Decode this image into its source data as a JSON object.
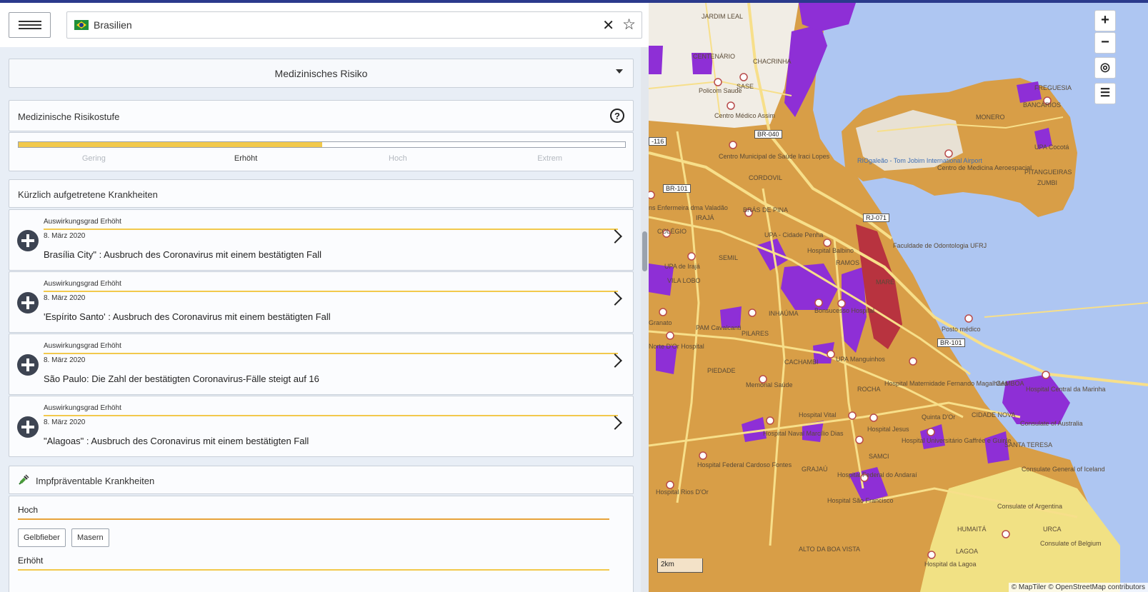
{
  "header": {
    "country": "Brasilien",
    "menu_icon": "hamburger-icon",
    "clear_icon": "close-icon",
    "favorite_icon": "star-icon"
  },
  "dropdown": {
    "label": "Medizinisches Risiko"
  },
  "risk": {
    "title": "Medizinische Risikostufe",
    "levels": [
      "Gering",
      "Erhöht",
      "Hoch",
      "Extrem"
    ],
    "active_level": "Erhöht",
    "fill_fraction": 0.5,
    "fill_color": "#f2c94c"
  },
  "recent": {
    "title": "Kürzlich aufgetretene Krankheiten",
    "items": [
      {
        "severity": "Auswirkungsgrad Erhöht",
        "date": "8. März 2020",
        "title": "Brasília City\" : Ausbruch des Coronavirus mit einem bestätigten Fall"
      },
      {
        "severity": "Auswirkungsgrad Erhöht",
        "date": "8. März 2020",
        "title": "'Espírito Santo' : Ausbruch des Coronavirus mit einem bestätigten Fall"
      },
      {
        "severity": "Auswirkungsgrad Erhöht",
        "date": "8. März 2020",
        "title": "São Paulo: Die Zahl der bestätigten Coronavirus-Fälle steigt auf 16"
      },
      {
        "severity": "Auswirkungsgrad Erhöht",
        "date": "8. März 2020",
        "title": "\"Alagoas\" : Ausbruch des Coronavirus mit einem bestätigten Fall"
      }
    ]
  },
  "vaccine": {
    "title": "Impfpräventable Krankheiten",
    "level_high": "Hoch",
    "level_high_color": "#e8a33a",
    "tags": [
      "Gelbfieber",
      "Masern"
    ],
    "level_elevated": "Erhöht",
    "level_elevated_color": "#f2c94c"
  },
  "map": {
    "zoom_in": "+",
    "zoom_out": "−",
    "scale": "2km",
    "attribution": "© MapTiler © OpenStreetMap contributors",
    "labels": {
      "jardim_leal": "JARDIM LEAL",
      "centenario": "CENTENÁRIO",
      "chacrinha": "CHACRINHA",
      "policom": "Policom Saude",
      "sase": "SASE",
      "centro_medico": "Centro Médico Assim",
      "freguesia": "FREGUESIA",
      "bancarios": "BANCÁRIOS",
      "monero": "MONERO",
      "upa_cocota": "UPA Cocotá",
      "pitangueiras": "PITANGUEIRAS",
      "zumbi": "ZUMBI",
      "rio_galeao": "RIOgaleão - Tom Jobim International Airport",
      "centro_med_aero": "Centro de Medicina Aeroespacial",
      "centro_municipal": "Centro Municipal de Saúde Iraci Lopes",
      "cordovil": "CORDOVIL",
      "bras_de_pina": "BRÁS DE PINA",
      "iraja": "IRAJÁ",
      "enfermeira": "ns Enfermeira dma Valadão",
      "colegio": "COLÉGIO",
      "upa_penha": "UPA - Cidade Penha",
      "hospital_balbino": "Hospital Balbino",
      "faculdade": "Faculdade de Odontologia UFRJ",
      "semil": "SEMIL",
      "upa_iraja": "UPA de Irajá",
      "vila_lobo": "VILA LOBO",
      "ramos": "RAMOS",
      "mare": "MARÉ",
      "bonsucesso": "Bonsucesso Hospital",
      "inhauma": "INHAÚMA",
      "pam_cavalcanti": "PAM Cavalcanti",
      "pilares": "PILARES",
      "granato": "Granato",
      "norte_dor": "Norte D'Or Hospital",
      "upa_manguinhos": "UPA Manguinhos",
      "cachambi": "CACHAMBI",
      "posto_medico": "Posto médico",
      "piedade": "PIEDADE",
      "memorial_saude": "Memorial Saúde",
      "rocha": "ROCHA",
      "hospital_maternidade": "Hospital Maternidade Fernando Magalhães",
      "gamboa": "GAMBOA",
      "hospital_marinha": "Hospital Central da Marinha",
      "hospital_vital": "Hospital Vital",
      "hospital_jesus": "Hospital Jesus",
      "quinta_dor": "Quinta D'Or",
      "cidade_nova": "CIDADE NOVA",
      "consulate_australia": "Consulate of Australia",
      "hospital_naval": "Hospital Naval Marcílio Dias",
      "hospital_universitario": "Hospital Universitário Gaffrée e Guinle",
      "samci": "SAMCI",
      "santa_teresa": "SANTA TERESA",
      "hospital_federal": "Hospital Federal Cardoso Fontes",
      "grajau": "GRAJAÚ",
      "hospital_andarai": "Hospital Federal do Andaraí",
      "consulate_iceland": "Consulate General of Iceland",
      "hospital_rios_dor": "Hospital Rios D'Or",
      "hospital_sao_francisco": "Hospital São Francisco",
      "consulate_argentina": "Consulate of Argentina",
      "alto_boa_vista": "ALTO DA BOA VISTA",
      "humaita": "HUMAITÁ",
      "urca": "URCA",
      "consulate_belgium": "Consulate of Belgium",
      "lagoa": "LAGOA",
      "hospital_lagoa": "Hospital da Lagoa",
      "road_br040": "BR-040",
      "road_rj071": "RJ-071",
      "road_br101a": "BR-101",
      "road_br101b": "BR-101",
      "road_116": "-116"
    },
    "colors": {
      "land": "#d89e47",
      "water": "#aec6f2",
      "risk_purple": "#8e2fd6",
      "risk_red": "#b8333f",
      "urban_light": "#f1ede5",
      "road": "#f7df8a",
      "south_yellow": "#f1e184"
    }
  }
}
